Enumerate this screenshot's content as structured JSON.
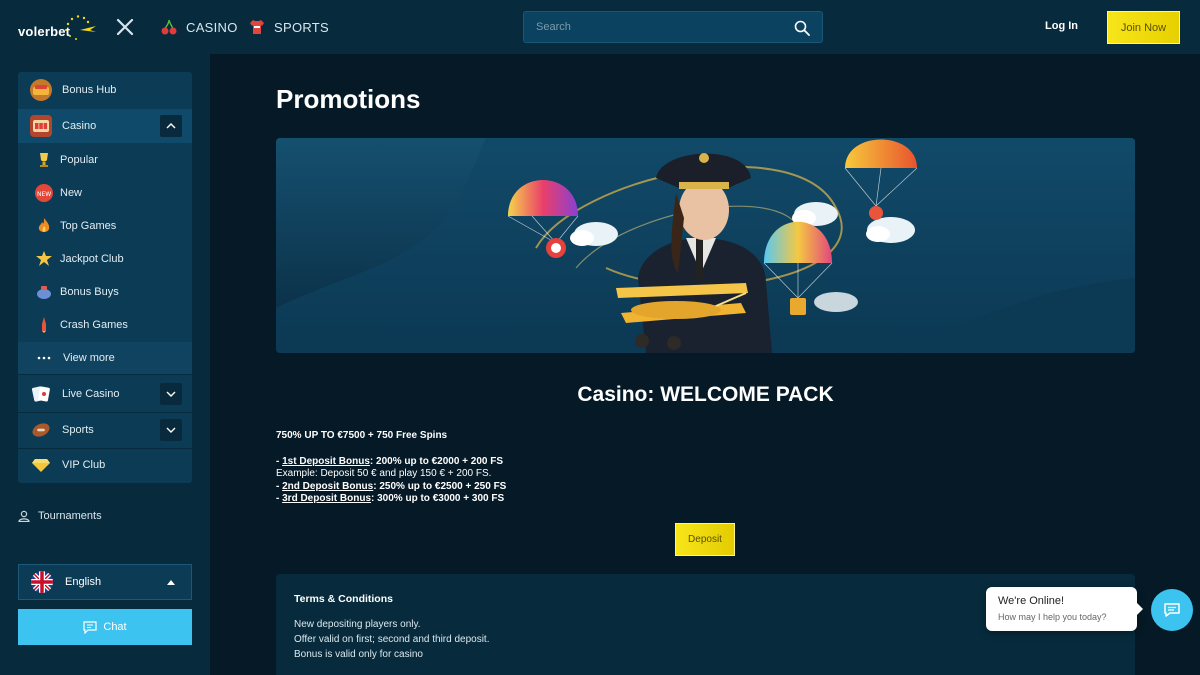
{
  "header": {
    "logo_text": "volerbet",
    "nav": [
      {
        "label": "CASINO",
        "icon": "cherry-icon"
      },
      {
        "label": "SPORTS",
        "icon": "jersey-icon"
      }
    ],
    "search_placeholder": "Search",
    "login_label": "Log In",
    "join_label": "Join Now"
  },
  "sidebar": {
    "items": [
      {
        "label": "Bonus Hub",
        "icon": "bonus-icon"
      },
      {
        "label": "Casino",
        "icon": "slot-machine-icon",
        "expanded": true
      },
      {
        "label": "Popular",
        "icon": "trophy-icon"
      },
      {
        "label": "New",
        "icon": "new-badge-icon"
      },
      {
        "label": "Top Games",
        "icon": "flame-icon"
      },
      {
        "label": "Jackpot Club",
        "icon": "jackpot-icon"
      },
      {
        "label": "Bonus Buys",
        "icon": "money-bag-icon"
      },
      {
        "label": "Crash Games",
        "icon": "rocket-icon"
      },
      {
        "label": "View more",
        "icon": "dots-icon"
      },
      {
        "label": "Live Casino",
        "icon": "cards-icon"
      },
      {
        "label": "Sports",
        "icon": "football-icon"
      },
      {
        "label": "VIP Club",
        "icon": "diamond-icon"
      }
    ],
    "tournaments_label": "Tournaments",
    "language": "English",
    "chat_label": "Chat"
  },
  "main": {
    "page_title": "Promotions",
    "promo_title": "Casino: WELCOME PACK",
    "headline": "750% UP TO €7500 + 750 Free Spins",
    "bonus_1_label": "1st Deposit Bonus",
    "bonus_1_text": ": 200% up to €2000 + 200 FS",
    "example": "Example: Deposit 50 € and play 150 €  + 200 FS.",
    "bonus_2_label": "2nd Deposit Bonus",
    "bonus_2_text": ": 250% up to €2500 + 250 FS",
    "bonus_3_label": "3rd Deposit Bonus",
    "bonus_3_text": ": 300% up to €3000 + 300 FS",
    "dash": "- ",
    "deposit_label": "Deposit",
    "terms_title": "Terms & Conditions",
    "terms_lines": [
      "New depositing players only.",
      "Offer valid on first; second and third deposit.",
      "Bonus is valid only for casino"
    ]
  },
  "chat_widget": {
    "title": "We're Online!",
    "subtitle": "How may I help you today?"
  },
  "colors": {
    "background": "#051a26",
    "panel": "#072b3d",
    "accent_yellow": "#f7e51a",
    "accent_blue": "#3dc3ef"
  }
}
